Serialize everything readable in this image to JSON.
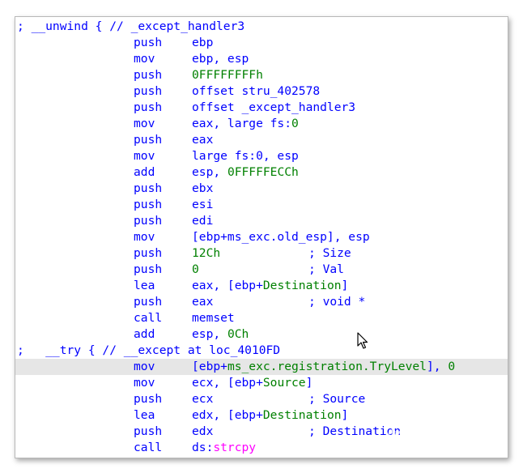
{
  "listing": {
    "lines": [
      {
        "kind": "comment",
        "text": "; __unwind { // _except_handler3"
      },
      {
        "kind": "instr",
        "mnemonic": "push",
        "operands": [
          {
            "t": "ebp",
            "c": "op"
          }
        ]
      },
      {
        "kind": "instr",
        "mnemonic": "mov",
        "operands": [
          {
            "t": "ebp, esp",
            "c": "op"
          }
        ]
      },
      {
        "kind": "instr",
        "mnemonic": "push",
        "operands": [
          {
            "t": "0FFFFFFFFh",
            "c": "num"
          }
        ]
      },
      {
        "kind": "instr",
        "mnemonic": "push",
        "operands": [
          {
            "t": "offset stru_402578",
            "c": "op"
          }
        ]
      },
      {
        "kind": "instr",
        "mnemonic": "push",
        "operands": [
          {
            "t": "offset _except_handler3",
            "c": "op"
          }
        ]
      },
      {
        "kind": "instr",
        "mnemonic": "mov",
        "operands": [
          {
            "t": "eax, large fs:",
            "c": "op"
          },
          {
            "t": "0",
            "c": "num"
          }
        ]
      },
      {
        "kind": "instr",
        "mnemonic": "push",
        "operands": [
          {
            "t": "eax",
            "c": "op"
          }
        ]
      },
      {
        "kind": "instr",
        "mnemonic": "mov",
        "operands": [
          {
            "t": "large fs:0, esp",
            "c": "op"
          }
        ]
      },
      {
        "kind": "instr",
        "mnemonic": "add",
        "operands": [
          {
            "t": "esp, ",
            "c": "op"
          },
          {
            "t": "0FFFFFECCh",
            "c": "num"
          }
        ]
      },
      {
        "kind": "instr",
        "mnemonic": "push",
        "operands": [
          {
            "t": "ebx",
            "c": "op"
          }
        ]
      },
      {
        "kind": "instr",
        "mnemonic": "push",
        "operands": [
          {
            "t": "esi",
            "c": "op"
          }
        ]
      },
      {
        "kind": "instr",
        "mnemonic": "push",
        "operands": [
          {
            "t": "edi",
            "c": "op"
          }
        ]
      },
      {
        "kind": "instr",
        "mnemonic": "mov",
        "operands": [
          {
            "t": "[ebp+ms_exc.old_esp], esp",
            "c": "op"
          }
        ]
      },
      {
        "kind": "instr",
        "mnemonic": "push",
        "operands": [
          {
            "t": "12Ch",
            "c": "num"
          }
        ],
        "comment": "; Size"
      },
      {
        "kind": "instr",
        "mnemonic": "push",
        "operands": [
          {
            "t": "0",
            "c": "num"
          }
        ],
        "comment": "; Val"
      },
      {
        "kind": "instr",
        "mnemonic": "lea",
        "operands": [
          {
            "t": "eax, [ebp+",
            "c": "op"
          },
          {
            "t": "Destination",
            "c": "var"
          },
          {
            "t": "]",
            "c": "op"
          }
        ]
      },
      {
        "kind": "instr",
        "mnemonic": "push",
        "operands": [
          {
            "t": "eax",
            "c": "op"
          }
        ],
        "comment": "; void *"
      },
      {
        "kind": "instr",
        "mnemonic": "call",
        "operands": [
          {
            "t": "memset",
            "c": "op"
          }
        ]
      },
      {
        "kind": "instr",
        "mnemonic": "add",
        "operands": [
          {
            "t": "esp, ",
            "c": "op"
          },
          {
            "t": "0Ch",
            "c": "num"
          }
        ]
      },
      {
        "kind": "comment",
        "text": ";   __try { // __except at loc_4010FD"
      },
      {
        "kind": "instr",
        "highlight": true,
        "mnemonic": "mov",
        "operands": [
          {
            "t": "[ebp+",
            "c": "op"
          },
          {
            "t": "ms_exc.registration.TryLevel",
            "c": "var"
          },
          {
            "t": "], ",
            "c": "op"
          },
          {
            "t": "0",
            "c": "num"
          }
        ]
      },
      {
        "kind": "instr",
        "mnemonic": "mov",
        "operands": [
          {
            "t": "ecx, [ebp+",
            "c": "op"
          },
          {
            "t": "Source",
            "c": "var"
          },
          {
            "t": "]",
            "c": "op"
          }
        ]
      },
      {
        "kind": "instr",
        "mnemonic": "push",
        "operands": [
          {
            "t": "ecx",
            "c": "op"
          }
        ],
        "comment": "; Source"
      },
      {
        "kind": "instr",
        "mnemonic": "lea",
        "operands": [
          {
            "t": "edx, [ebp+",
            "c": "op"
          },
          {
            "t": "Destination",
            "c": "var"
          },
          {
            "t": "]",
            "c": "op"
          }
        ]
      },
      {
        "kind": "instr",
        "mnemonic": "push",
        "operands": [
          {
            "t": "edx",
            "c": "op"
          }
        ],
        "comment": "; Destination"
      },
      {
        "kind": "instr",
        "mnemonic": "call",
        "operands": [
          {
            "t": "ds:",
            "c": "op"
          },
          {
            "t": "strcpy",
            "c": "imp"
          }
        ]
      }
    ]
  },
  "watermark": {
    "text": "看雪",
    "icon": "snowflake-icon"
  },
  "colors": {
    "keyword": "#0000ff",
    "number": "#008000",
    "import": "#ff00ff",
    "highlight": "#e6e6e6"
  }
}
